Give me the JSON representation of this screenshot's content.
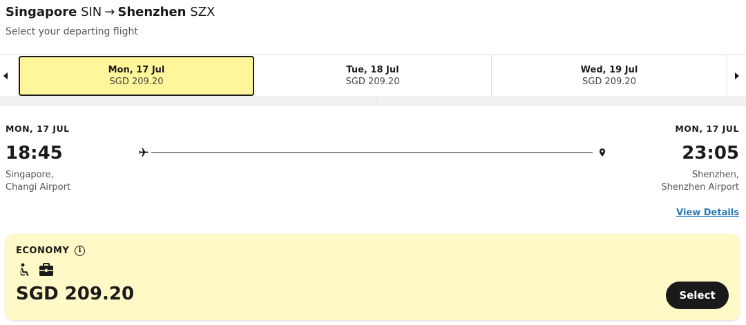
{
  "header": {
    "origin_city": "Singapore",
    "origin_code": "SIN",
    "arrow": "→",
    "destination_city": "Shenzhen",
    "destination_code": "SZX",
    "subtitle": "Select your departing flight"
  },
  "date_tabs": [
    {
      "date": "Mon, 17 Jul",
      "price": "SGD 209.20",
      "selected": true
    },
    {
      "date": "Tue, 18 Jul",
      "price": "SGD 209.20",
      "selected": false
    },
    {
      "date": "Wed, 19 Jul",
      "price": "SGD 209.20",
      "selected": false
    }
  ],
  "flight": {
    "departure": {
      "date": "MON, 17 JUL",
      "time": "18:45",
      "city": "Singapore,",
      "airport": "Changi Airport"
    },
    "arrival": {
      "date": "MON, 17 JUL",
      "time": "23:05",
      "city": "Shenzhen,",
      "airport": "Shenzhen Airport"
    },
    "view_details_label": "View Details"
  },
  "fare": {
    "class_label": "ECONOMY",
    "info_icon_glyph": "i",
    "amenity_icons": [
      "seat-icon",
      "baggage-icon"
    ],
    "price": "SGD 209.20",
    "select_label": "Select"
  },
  "colors": {
    "selected_tab_bg": "#fff59a",
    "fare_card_bg": "#fff8c7",
    "link": "#2a7ab8",
    "button_bg": "#1a1a1a"
  }
}
